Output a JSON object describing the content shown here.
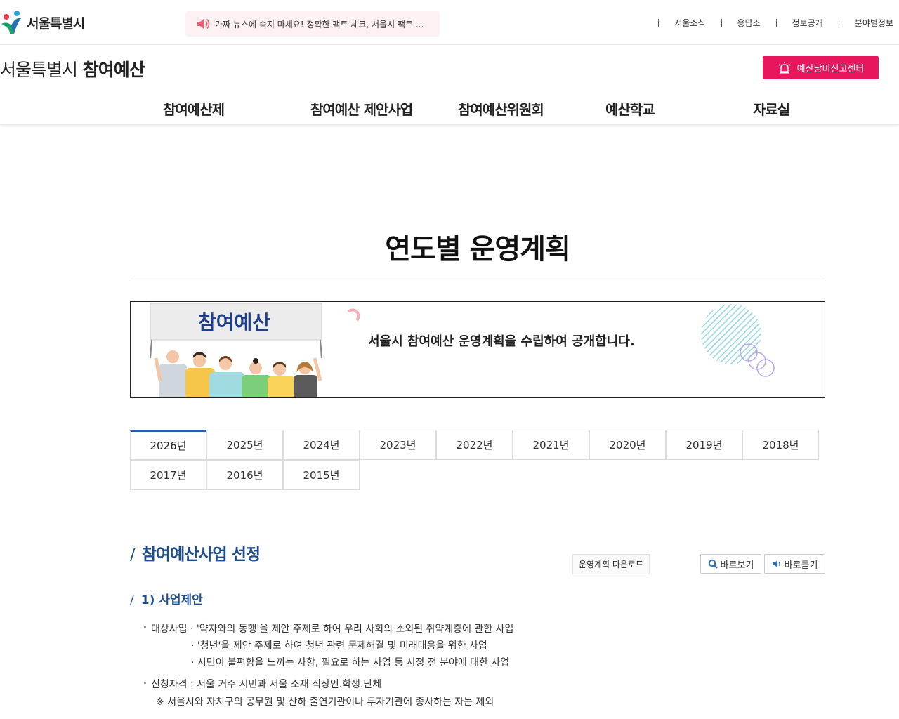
{
  "topbar": {
    "logo_text": "서울특별시",
    "ticker_text": "가짜 뉴스에 속지 마세요! 정확한 팩트 체크, 서울시 팩트 ...",
    "util_links": [
      "서울소식",
      "응답소",
      "정보공개",
      "분야별정보"
    ]
  },
  "header": {
    "site_title_part1": "서울특별시",
    "site_title_part2": "참여예산",
    "report_button": "예산낭비신고센터"
  },
  "gnb": {
    "items": [
      "참여예산제",
      "참여예산 제안사업",
      "참여예산위원회",
      "예산학교",
      "자료실"
    ]
  },
  "main": {
    "page_title": "연도별 운영계획",
    "banner": {
      "sign_text": "참여예산",
      "message": "서울시 참여예산 운영계획을 수립하여 공개합니다."
    },
    "year_tabs": [
      "2026년",
      "2025년",
      "2024년",
      "2023년",
      "2022년",
      "2021년",
      "2020년",
      "2019년",
      "2018년",
      "2017년",
      "2016년",
      "2015년"
    ],
    "active_tab": "2026년",
    "section_title": "참여예산사업 선정",
    "section_slash": "/",
    "download_button": "운영계획 다운로드",
    "view_button": "바로보기",
    "listen_button": "바로듣기",
    "sub_title": "1) 사업제안",
    "content": {
      "target_label": "대상사업 · '약자와의 동행'을 제안 주제로 하여 우리 사회의 소외된 취약계층에 관한 사업",
      "target_line2": "· '청년'을 제안 주제로 하여 청년 관련 문제해결 및 미래대응을 위한 사업",
      "target_line3": "· 시민이 불편함을 느끼는 사항, 필요로 하는 사업 등 시정 전 분야에 대한 사업",
      "eligibility": "신청자격 : 서울 거주 시민과 서울 소재 직장인.학생.단체",
      "note": "※ 서울시와 자치구의 공무원 및 산하 출연기관이나 투자기관에 종사하는 자는 제외"
    }
  },
  "colors": {
    "brand_blue": "#1f4e8c",
    "accent_pink": "#e8175d",
    "tab_active": "#2b5aa6"
  }
}
